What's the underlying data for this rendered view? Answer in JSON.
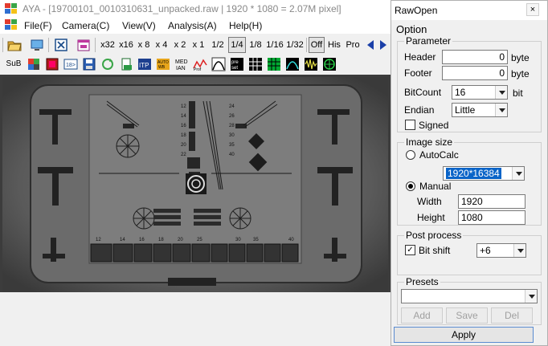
{
  "window": {
    "title": "AYA - [19700101_0010310631_unpacked.raw | 1920 * 1080 = 2.07M pixel]"
  },
  "menubar": {
    "items": [
      "File(F)",
      "Camera(C)",
      "View(V)",
      "Analysis(A)",
      "Help(H)"
    ]
  },
  "toolbar": {
    "zoom_buttons": [
      "x32",
      "x16",
      "x 8",
      "x 4",
      "x 2",
      "x 1",
      "1/2",
      "1/4",
      "1/8",
      "1/16",
      "1/32"
    ],
    "selected_zoom": "1/4",
    "mode_buttons": [
      "Off",
      "His",
      "Pro"
    ],
    "sub_label": "SuB",
    "icons": [
      "open-folder",
      "monitor",
      "close-x",
      "calendar",
      "color-grid",
      "image-red",
      "arrow-18",
      "save-disk",
      "sync",
      "doc-green",
      "itp",
      "auto-red",
      "median",
      "profile",
      "curve",
      "preset",
      "grid-white",
      "grid-green",
      "wave-cyan",
      "waveform",
      "color-wheel"
    ]
  },
  "chart_labels": {
    "top_numbers": [
      "12",
      "14",
      "16",
      "18",
      "20",
      "22",
      "24",
      "26",
      "28",
      "30",
      "35",
      "40"
    ],
    "bottom_numbers": [
      "12",
      "14",
      "16",
      "18",
      "20",
      "25",
      "30",
      "35",
      "40"
    ]
  },
  "dialog": {
    "title": "RawOpen",
    "close_label": "×",
    "menu": "Option",
    "parameter": {
      "legend": "Parameter",
      "header_label": "Header",
      "header_value": "0",
      "header_unit": "byte",
      "footer_label": "Footer",
      "footer_value": "0",
      "footer_unit": "byte",
      "bitcount_label": "BitCount",
      "bitcount_value": "16",
      "bitcount_unit": "bit",
      "endian_label": "Endian",
      "endian_value": "Little",
      "signed_label": "Signed",
      "signed_checked": false
    },
    "image_size": {
      "legend": "Image size",
      "autocalc_label": "AutoCalc",
      "autocalc_selected": false,
      "autocalc_value": "1920*16384",
      "manual_label": "Manual",
      "manual_selected": true,
      "width_label": "Width",
      "width_value": "1920",
      "height_label": "Height",
      "height_value": "1080"
    },
    "post_process": {
      "legend": "Post process",
      "bitshift_label": "Bit shift",
      "bitshift_checked": true,
      "bitshift_value": "+6"
    },
    "presets": {
      "legend": "Presets",
      "value": "",
      "add_label": "Add",
      "save_label": "Save",
      "del_label": "Del"
    },
    "apply_label": "Apply"
  }
}
